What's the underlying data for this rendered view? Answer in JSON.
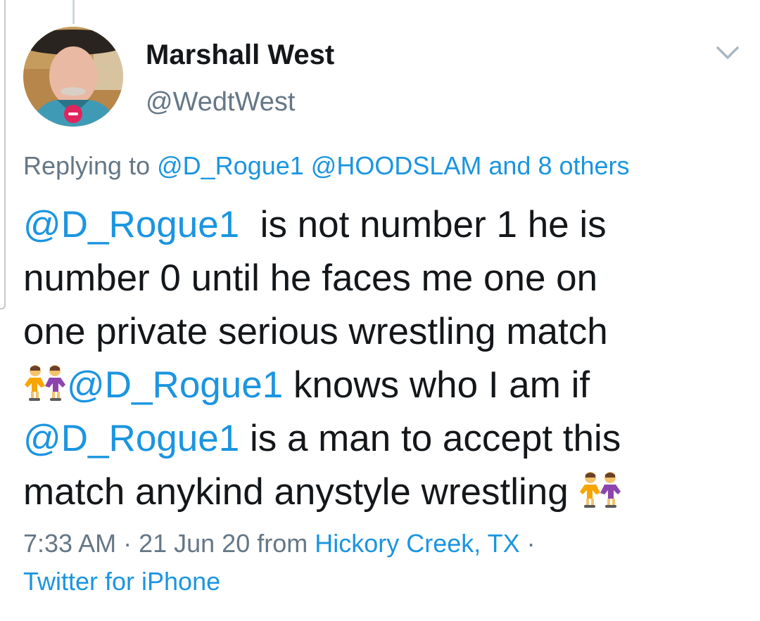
{
  "tweet": {
    "author": {
      "name": "Marshall West",
      "handle": "@WedtWest"
    },
    "replying": {
      "prefix": "Replying to ",
      "mention1": "@D_Rogue1",
      "mention2": "@HOODSLAM",
      "others": "and 8 others"
    },
    "body": {
      "l1_mention": "@D_Rogue1",
      "l1_text": "  is not number 1 he is",
      "l2_text": "number 0 until he faces me one on",
      "l3_text": "one private serious wrestling match",
      "l4_mention": "@D_Rogue1",
      "l4_text": " knows who I am if",
      "l5_mention": "@D_Rogue1",
      "l5_text": " is a man to accept this",
      "l6_text": "match anykind anystyle wrestling "
    },
    "meta": {
      "time": "7:33 AM",
      "sep1": " · ",
      "date": "21 Jun 20",
      "from": " from ",
      "location": "Hickory Creek, TX",
      "sep2": " ·",
      "source": "Twitter for iPhone"
    },
    "icons": {
      "emoji": "women-wrestling-emoji",
      "menu": "chevron-down-icon"
    },
    "colors": {
      "link": "#1b95e0",
      "secondary": "#657786",
      "text": "#14171a"
    }
  }
}
